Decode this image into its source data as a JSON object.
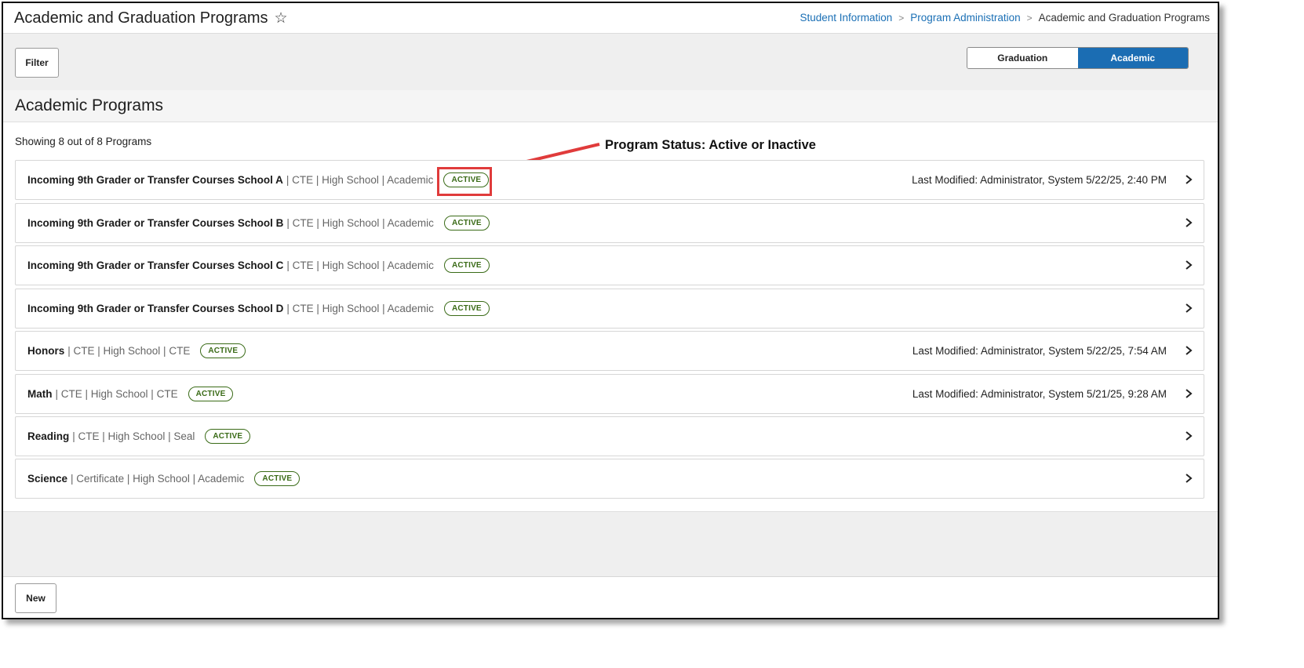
{
  "header": {
    "title": "Academic and Graduation Programs",
    "favorite_icon": "star-outline-icon",
    "breadcrumb": [
      {
        "label": "Student Information"
      },
      {
        "label": "Program Administration"
      },
      {
        "label": "Academic and Graduation Programs"
      }
    ]
  },
  "toolbar": {
    "filter_label": "Filter",
    "toggle": [
      {
        "label": "Graduation",
        "selected": false
      },
      {
        "label": "Academic",
        "selected": true
      }
    ],
    "accent_color": "#1b6db3"
  },
  "section": {
    "title": "Academic Programs",
    "showing_text": "Showing 8 out of 8 Programs"
  },
  "callout": {
    "label": "Program Status: Active or Inactive",
    "color": "#e03b3b"
  },
  "programs": [
    {
      "name": "Incoming 9th Grader or Transfer Courses School A",
      "meta": "| CTE | High School | Academic",
      "status": "ACTIVE",
      "modified": "Last Modified: Administrator, System 5/22/25, 2:40 PM"
    },
    {
      "name": "Incoming 9th Grader or Transfer Courses School B",
      "meta": "| CTE | High School | Academic",
      "status": "ACTIVE",
      "modified": ""
    },
    {
      "name": "Incoming 9th Grader or Transfer Courses School C",
      "meta": "| CTE | High School | Academic",
      "status": "ACTIVE",
      "modified": ""
    },
    {
      "name": "Incoming 9th Grader or Transfer Courses School D",
      "meta": "| CTE | High School | Academic",
      "status": "ACTIVE",
      "modified": ""
    },
    {
      "name": "Honors",
      "meta": "| CTE | High School | CTE",
      "status": "ACTIVE",
      "modified": "Last Modified: Administrator, System 5/22/25, 7:54 AM"
    },
    {
      "name": "Math",
      "meta": "| CTE | High School | CTE",
      "status": "ACTIVE",
      "modified": "Last Modified: Administrator, System 5/21/25, 9:28 AM"
    },
    {
      "name": "Reading",
      "meta": "| CTE | High School | Seal",
      "status": "ACTIVE",
      "modified": ""
    },
    {
      "name": "Science",
      "meta": "| Certificate | High School | Academic",
      "status": "ACTIVE",
      "modified": ""
    }
  ],
  "status_color": "#3a6b17",
  "footer": {
    "new_label": "New"
  }
}
